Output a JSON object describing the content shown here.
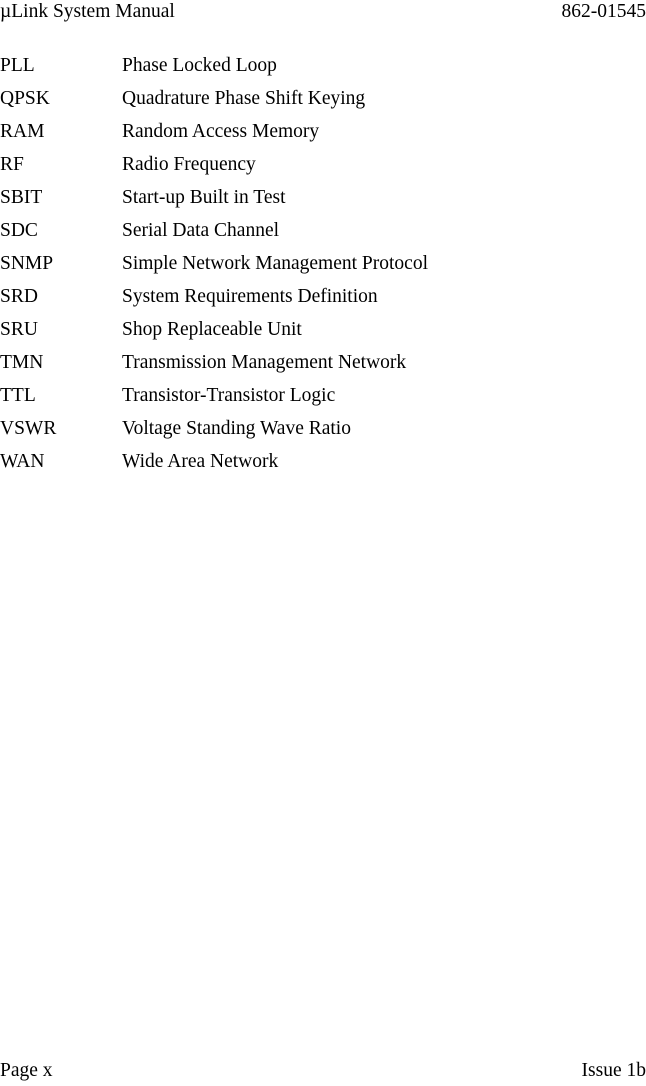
{
  "header": {
    "document_title": "µLink System Manual",
    "document_number": "862-01545"
  },
  "footer": {
    "page_label": "Page x",
    "issue_label": "Issue 1b"
  },
  "abbreviations": [
    {
      "term": "PLL",
      "definition": "Phase Locked Loop"
    },
    {
      "term": "QPSK",
      "definition": "Quadrature Phase Shift Keying"
    },
    {
      "term": "RAM",
      "definition": "Random Access Memory"
    },
    {
      "term": "RF",
      "definition": "Radio Frequency"
    },
    {
      "term": "SBIT",
      "definition": "Start-up Built in Test"
    },
    {
      "term": "SDC",
      "definition": "Serial Data Channel"
    },
    {
      "term": "SNMP",
      "definition": "Simple Network Management Protocol"
    },
    {
      "term": "SRD",
      "definition": "System Requirements Definition"
    },
    {
      "term": "SRU",
      "definition": "Shop Replaceable Unit"
    },
    {
      "term": "TMN",
      "definition": "Transmission Management Network"
    },
    {
      "term": "TTL",
      "definition": "Transistor-Transistor Logic"
    },
    {
      "term": "VSWR",
      "definition": "Voltage Standing Wave Ratio"
    },
    {
      "term": "WAN",
      "definition": "Wide Area Network"
    }
  ]
}
